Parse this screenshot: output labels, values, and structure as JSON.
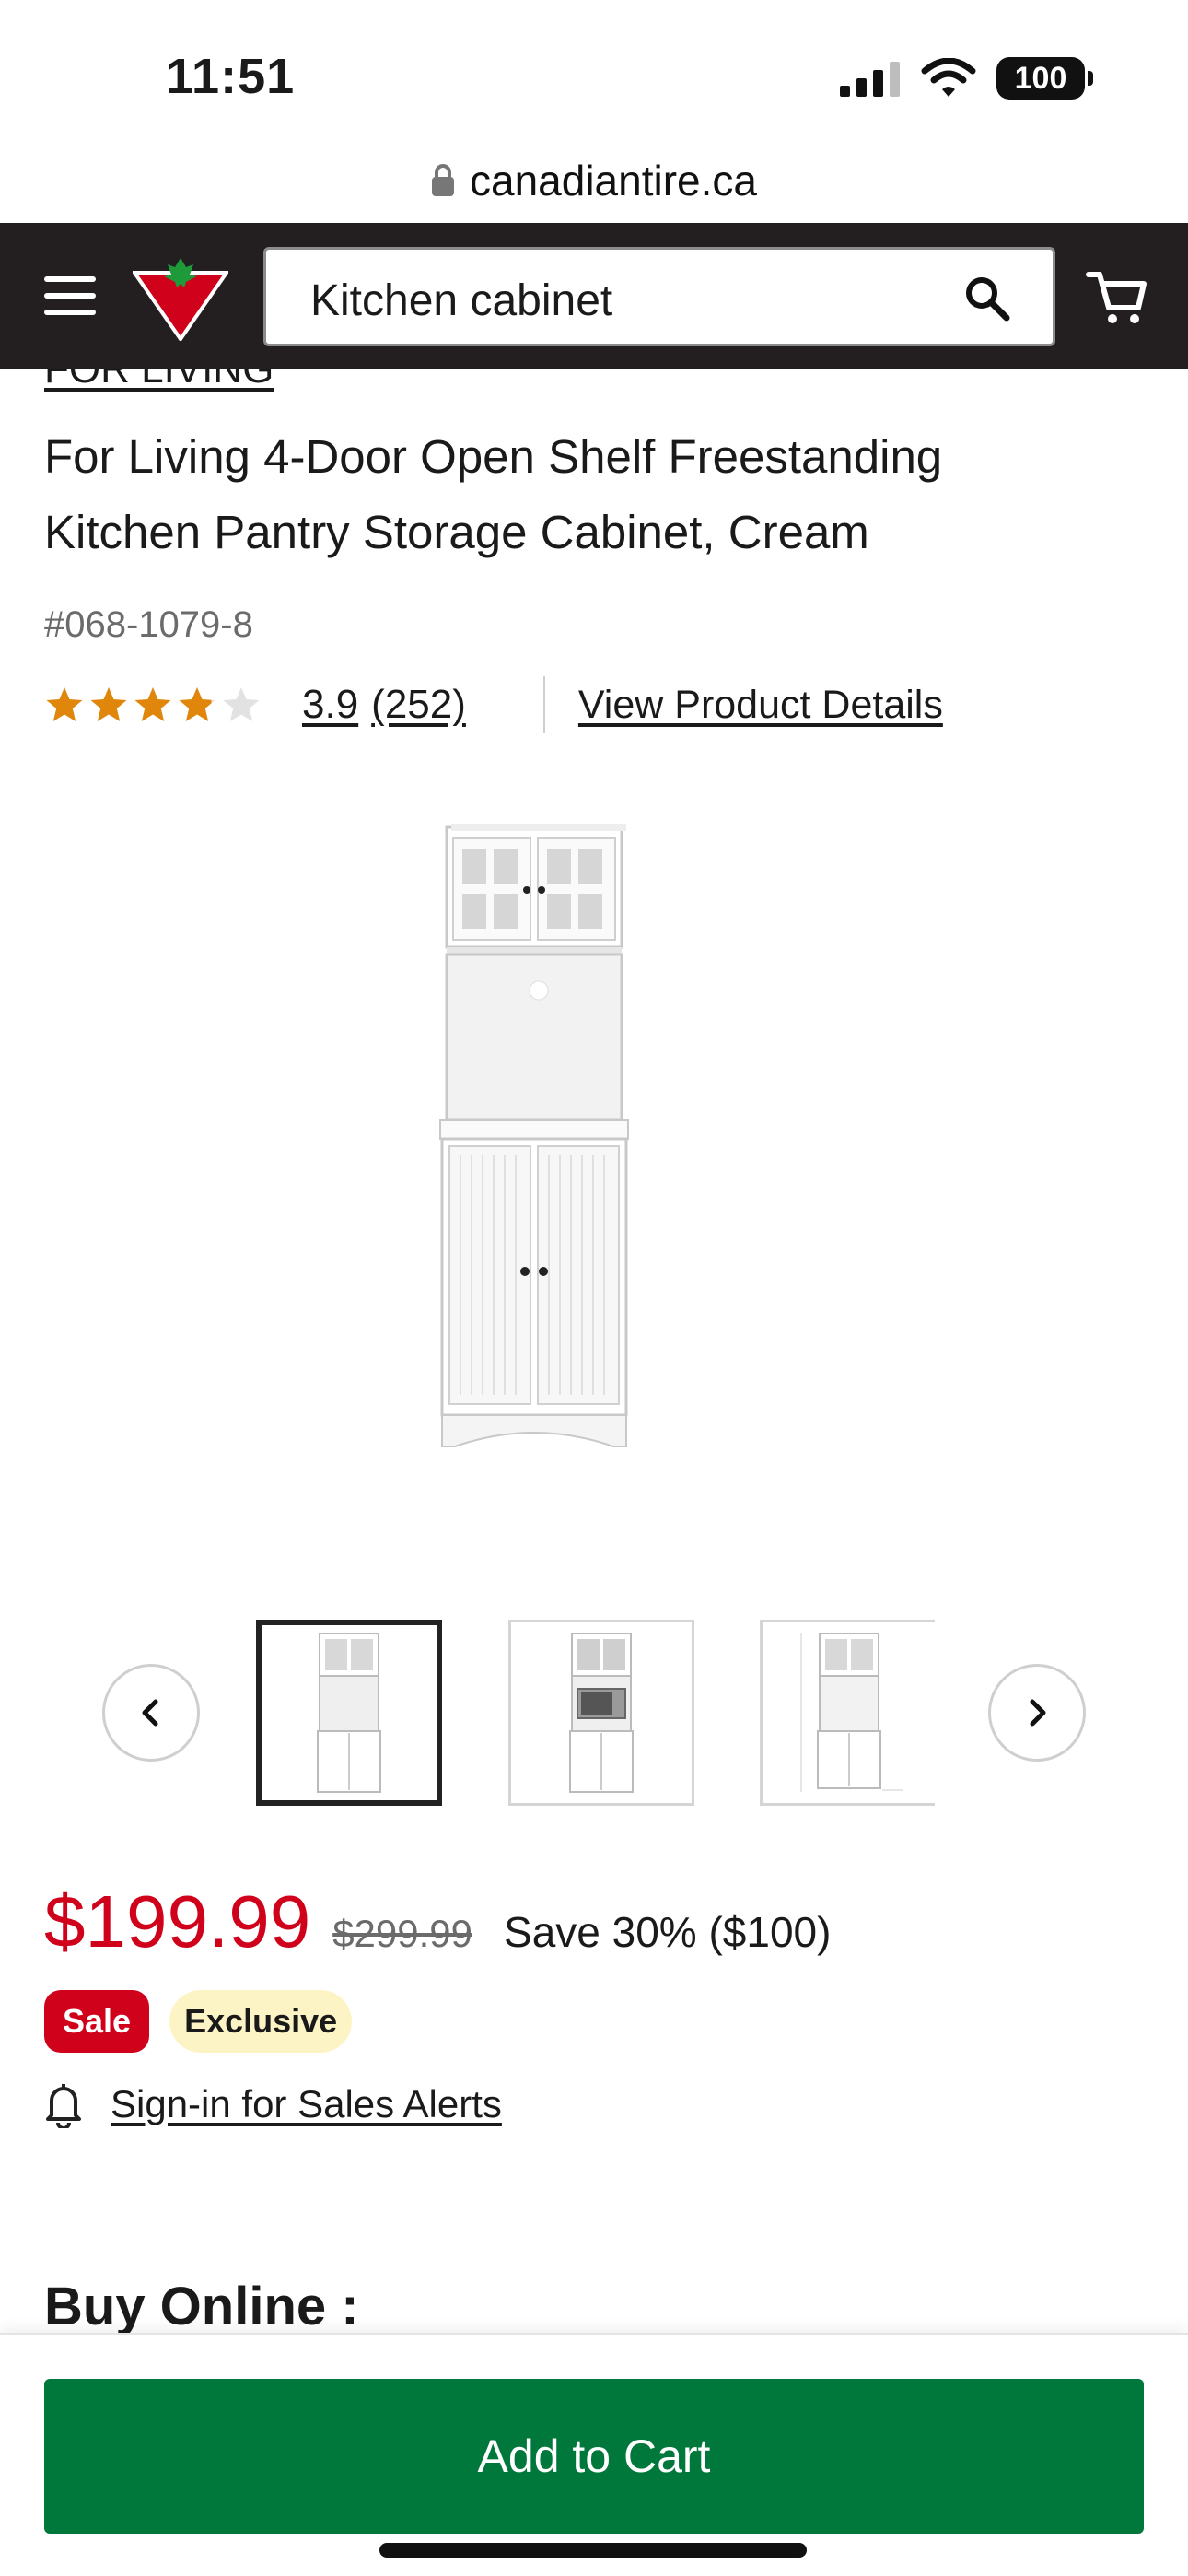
{
  "status_bar": {
    "time": "11:51",
    "battery": "100"
  },
  "browser": {
    "url": "canadiantire.ca"
  },
  "header": {
    "search_value": "Kitchen cabinet"
  },
  "product": {
    "brand": "FOR LIVING",
    "title_line1": "For Living 4-Door Open Shelf Freestanding",
    "title_line2": "Kitchen Pantry Storage Cabinet, Cream",
    "sku": "#068-1079-8",
    "rating": "3.9",
    "rating_stars": 3.9,
    "review_count": "(252)",
    "details_link": "View Product Details"
  },
  "gallery": {
    "active_index": 0,
    "thumbnails": [
      "cabinet-front",
      "cabinet-with-microwave",
      "cabinet-dimensions"
    ]
  },
  "pricing": {
    "sale_price": "$199.99",
    "was_price": "$299.99",
    "savings": "Save 30% ($100)",
    "badge_sale": "Sale",
    "badge_exclusive": "Exclusive",
    "alert_link": "Sign-in for Sales Alerts"
  },
  "section": {
    "buy_online": "Buy Online :"
  },
  "footer": {
    "add_to_cart": "Add to Cart"
  },
  "colors": {
    "brand_red": "#d0021b",
    "header_bg": "#231f20",
    "cta_green": "#00783c",
    "star": "#e0860b"
  }
}
